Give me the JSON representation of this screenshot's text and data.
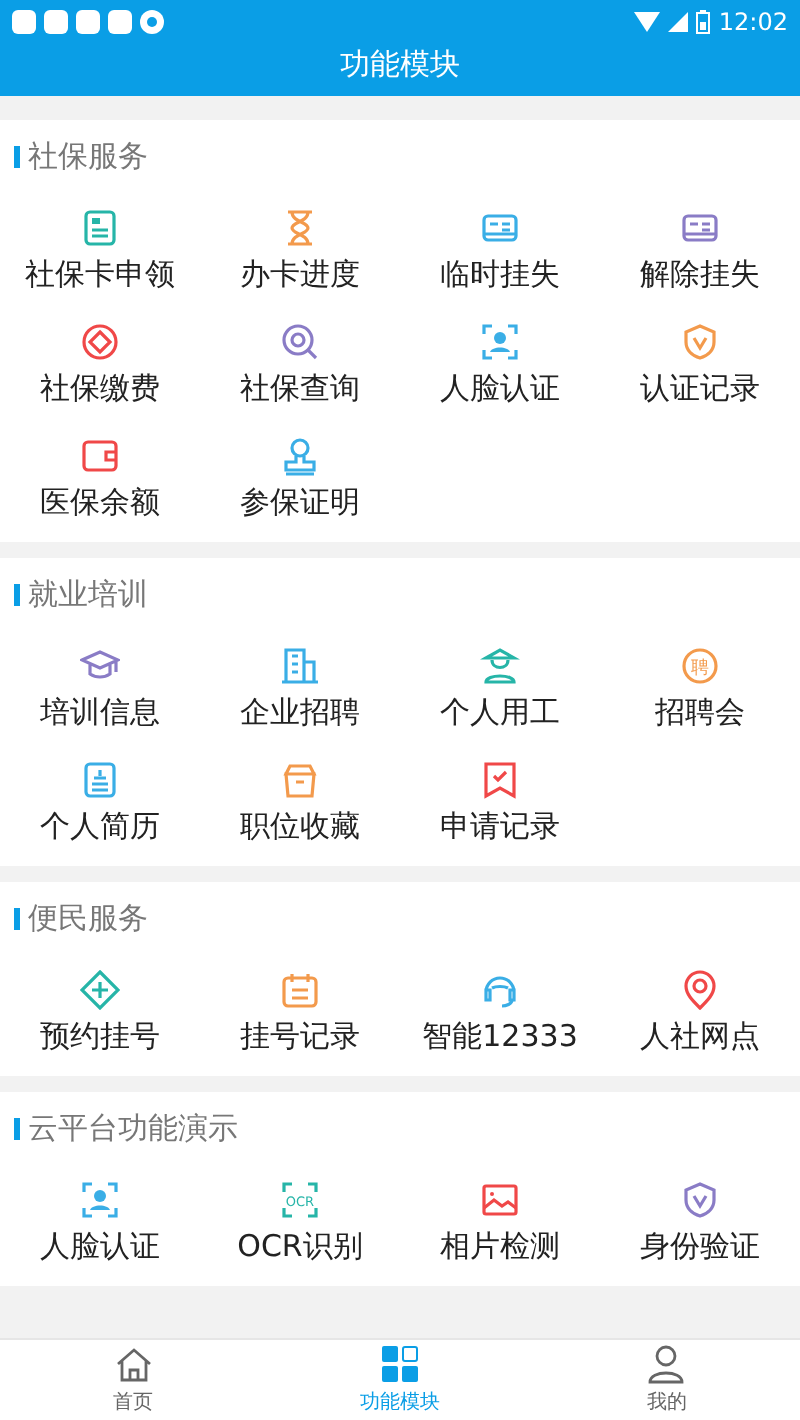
{
  "status_bar": {
    "time": "12:02"
  },
  "header": {
    "title": "功能模块"
  },
  "sections": [
    {
      "title": "社保服务",
      "items": [
        {
          "label": "社保卡申领",
          "color": "#26b5a8"
        },
        {
          "label": "办卡进度",
          "color": "#f39a4c"
        },
        {
          "label": "临时挂失",
          "color": "#3aaee6"
        },
        {
          "label": "解除挂失",
          "color": "#8a7cc6"
        },
        {
          "label": "社保缴费",
          "color": "#f04848"
        },
        {
          "label": "社保查询",
          "color": "#8a7cc6"
        },
        {
          "label": "人脸认证",
          "color": "#3aaee6"
        },
        {
          "label": "认证记录",
          "color": "#f39a4c"
        },
        {
          "label": "医保余额",
          "color": "#f04848"
        },
        {
          "label": "参保证明",
          "color": "#3aaee6"
        }
      ]
    },
    {
      "title": "就业培训",
      "items": [
        {
          "label": "培训信息",
          "color": "#8a7cc6"
        },
        {
          "label": "企业招聘",
          "color": "#3aaee6"
        },
        {
          "label": "个人用工",
          "color": "#26b5a8"
        },
        {
          "label": "招聘会",
          "color": "#f39a4c",
          "icon_text": "聘"
        },
        {
          "label": "个人简历",
          "color": "#3aaee6"
        },
        {
          "label": "职位收藏",
          "color": "#f39a4c"
        },
        {
          "label": "申请记录",
          "color": "#f04848"
        }
      ]
    },
    {
      "title": "便民服务",
      "items": [
        {
          "label": "预约挂号",
          "color": "#26b5a8"
        },
        {
          "label": "挂号记录",
          "color": "#f39a4c"
        },
        {
          "label": "智能12333",
          "color": "#3aaee6"
        },
        {
          "label": "人社网点",
          "color": "#f04848"
        }
      ]
    },
    {
      "title": "云平台功能演示",
      "items": [
        {
          "label": "人脸认证",
          "color": "#3aaee6"
        },
        {
          "label": "OCR识别",
          "color": "#26b5a8",
          "icon_text": "OCR"
        },
        {
          "label": "相片检测",
          "color": "#f04848"
        },
        {
          "label": "身份验证",
          "color": "#8a7cc6"
        }
      ]
    }
  ],
  "tab_bar": [
    {
      "label": "首页",
      "selected": false
    },
    {
      "label": "功能模块",
      "selected": true
    },
    {
      "label": "我的",
      "selected": false
    }
  ]
}
